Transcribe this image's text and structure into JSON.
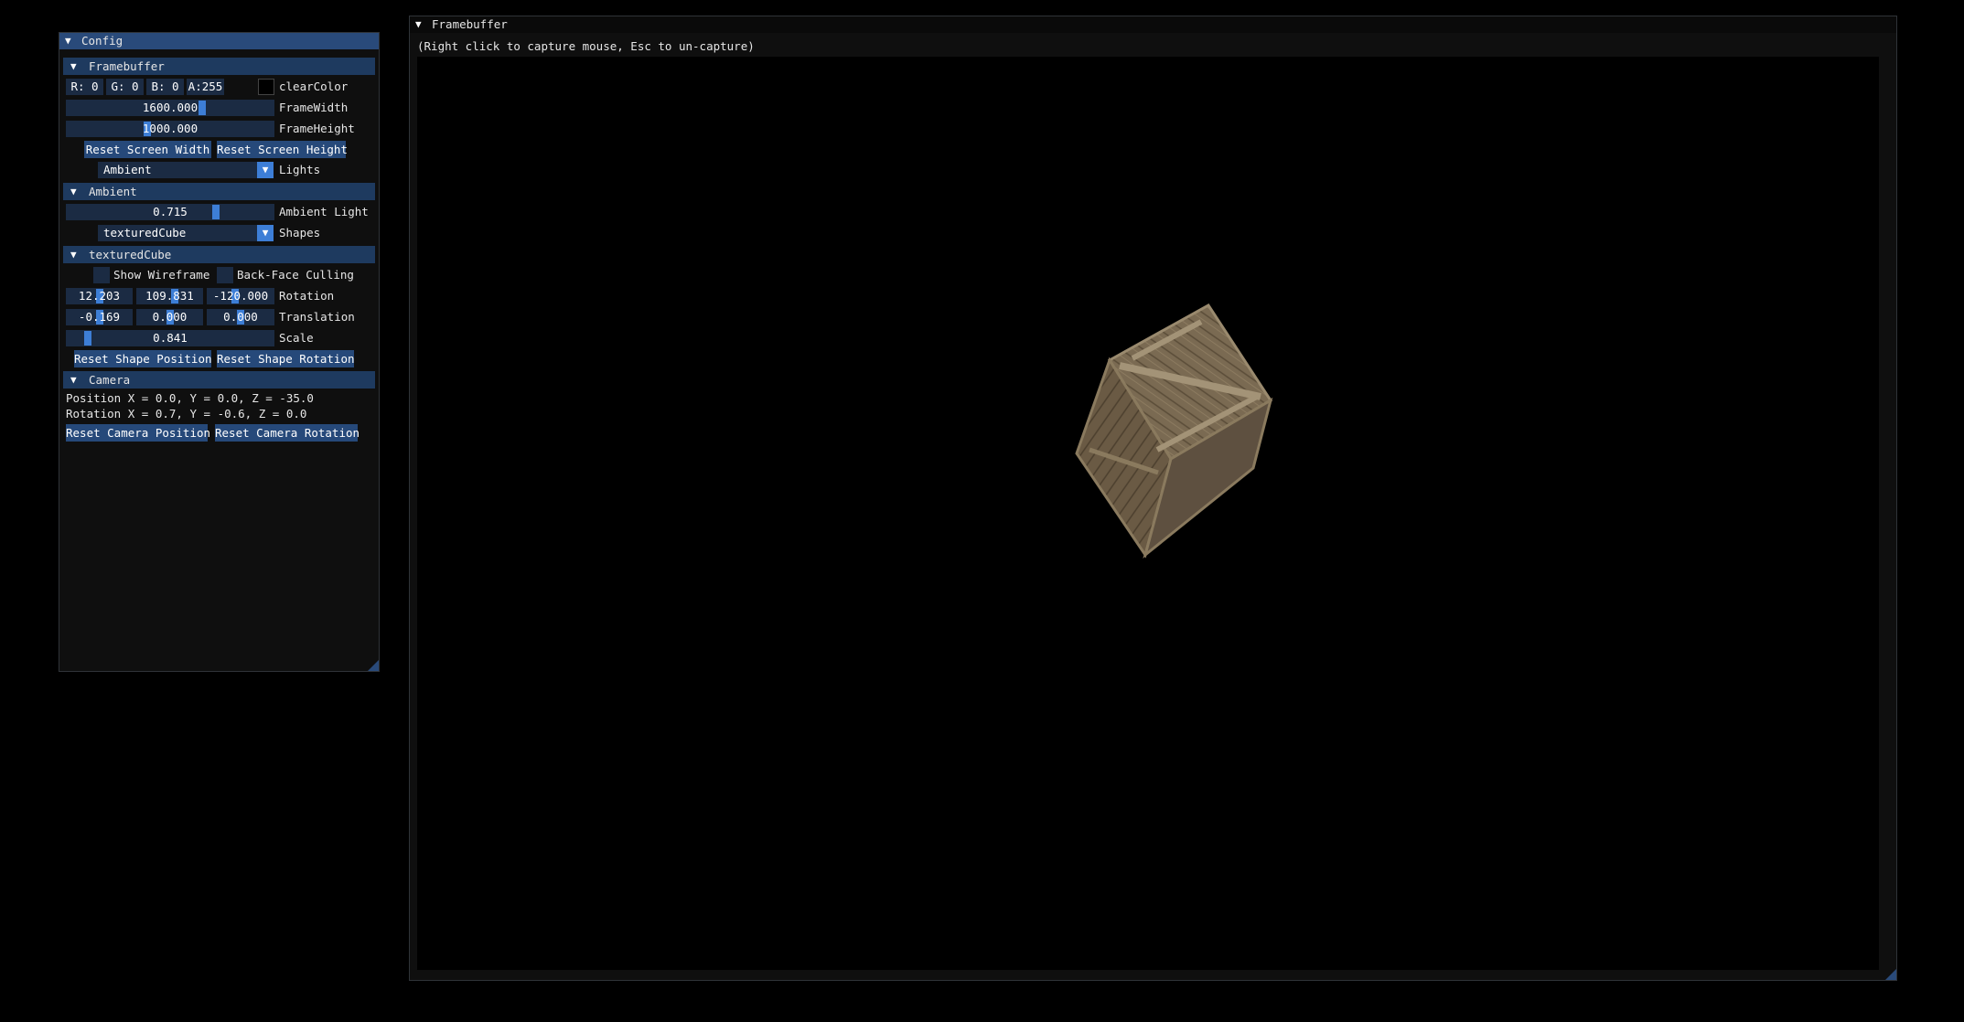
{
  "config": {
    "title": "Config",
    "framebuffer_header": "Framebuffer",
    "clear_color": {
      "r": "R:  0",
      "g": "G:  0",
      "b": "B:  0",
      "a": "A:255",
      "label": "clearColor",
      "swatch": "#000000"
    },
    "frame_width": {
      "value": "1600.000",
      "label": "FrameWidth",
      "fraction": 0.64
    },
    "frame_height": {
      "value": "1000.000",
      "label": "FrameHeight",
      "fraction": 0.39
    },
    "reset_screen_width": "Reset Screen Width",
    "reset_screen_height": "Reset Screen Height",
    "lights": {
      "selected": "Ambient",
      "label": "Lights"
    },
    "ambient_header": "Ambient",
    "ambient_light": {
      "value": "0.715",
      "label": "Ambient Light",
      "fraction": 0.715
    },
    "shapes": {
      "selected": "texturedCube",
      "label": "Shapes"
    },
    "shape_header": "texturedCube",
    "show_wireframe": "Show Wireframe",
    "back_face_culling": "Back-Face Culling",
    "rotation": {
      "x": "12.203",
      "y": "109.831",
      "z": "-120.000",
      "label": "Rotation"
    },
    "translation": {
      "x": "-0.169",
      "y": "0.000",
      "z": "0.000",
      "label": "Translation"
    },
    "scale": {
      "value": "0.841",
      "label": "Scale",
      "fraction": 0.09
    },
    "reset_shape_position": "Reset Shape Position",
    "reset_shape_rotation": "Reset Shape Rotation",
    "camera_header": "Camera",
    "camera_position": "Position X = 0.0, Y = 0.0, Z = -35.0",
    "camera_rotation": "Rotation X = 0.7, Y = -0.6, Z = 0.0",
    "reset_camera_position": "Reset Camera Position",
    "reset_camera_rotation": "Reset Camera Rotation"
  },
  "framebuffer": {
    "title": "Framebuffer",
    "hint": "(Right click to capture mouse, Esc to un-capture)"
  },
  "colors": {
    "accent": "#3d7ed6",
    "header": "#1e3a5f",
    "button": "#26497a",
    "frame_bg": "#1b2b43",
    "window_bg": "#0f0f0f"
  }
}
